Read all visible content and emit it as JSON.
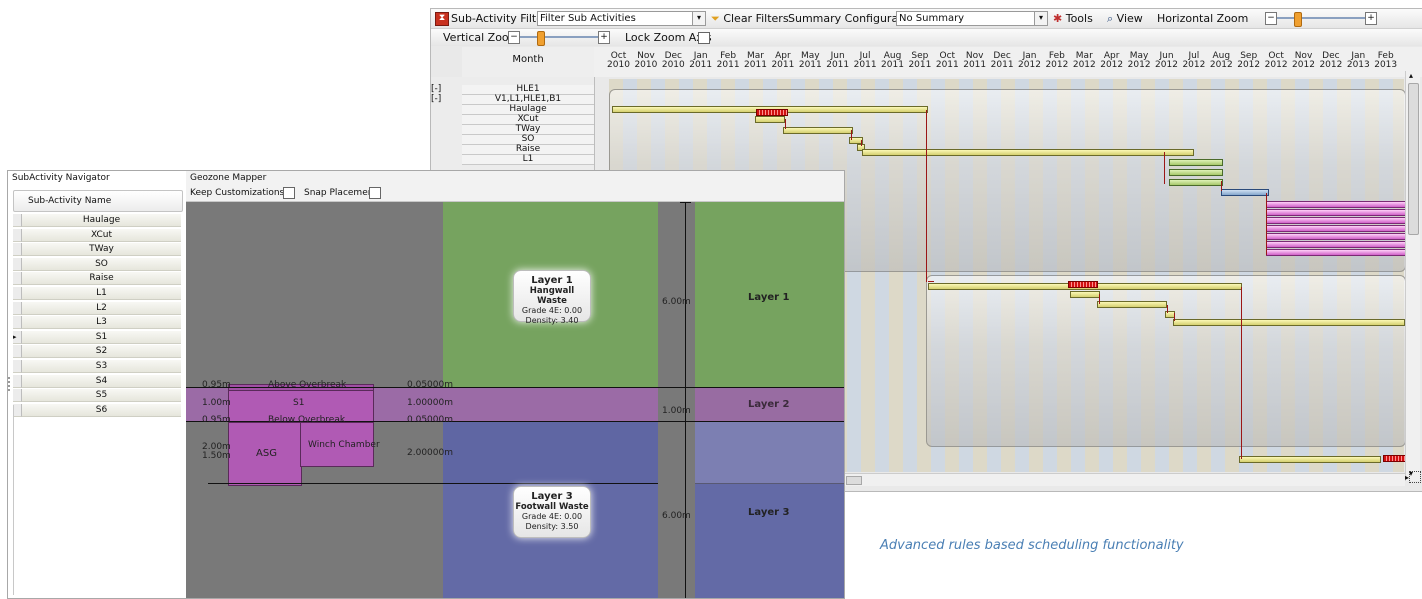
{
  "gantt": {
    "toolbar": {
      "sub_activity_filter_label": "Sub-Activity Filter",
      "sub_activity_filter_value": "Filter Sub Activities",
      "clear_filters_label": "Clear Filters",
      "summary_configuration_label": "Summary Configuration",
      "summary_configuration_value": "No Summary",
      "tools_label": "Tools",
      "view_label": "View",
      "horizontal_zoom_label": "Horizontal Zoom",
      "vertical_zoom_label": "Vertical Zoom",
      "lock_zoom_axis_label": "Lock Zoom Axis",
      "lock_zoom_axis_checked": false
    },
    "column_header": "Month",
    "months": [
      [
        "Oct",
        "2010"
      ],
      [
        "Nov",
        "2010"
      ],
      [
        "Dec",
        "2010"
      ],
      [
        "Jan",
        "2011"
      ],
      [
        "Feb",
        "2011"
      ],
      [
        "Mar",
        "2011"
      ],
      [
        "Apr",
        "2011"
      ],
      [
        "May",
        "2011"
      ],
      [
        "Jun",
        "2011"
      ],
      [
        "Jul",
        "2011"
      ],
      [
        "Aug",
        "2011"
      ],
      [
        "Sep",
        "2011"
      ],
      [
        "Oct",
        "2011"
      ],
      [
        "Nov",
        "2011"
      ],
      [
        "Dec",
        "2011"
      ],
      [
        "Jan",
        "2012"
      ],
      [
        "Feb",
        "2012"
      ],
      [
        "Mar",
        "2012"
      ],
      [
        "Apr",
        "2012"
      ],
      [
        "May",
        "2012"
      ],
      [
        "Jun",
        "2012"
      ],
      [
        "Jul",
        "2012"
      ],
      [
        "Aug",
        "2012"
      ],
      [
        "Sep",
        "2012"
      ],
      [
        "Oct",
        "2012"
      ],
      [
        "Nov",
        "2012"
      ],
      [
        "Dec",
        "2012"
      ],
      [
        "Jan",
        "2013"
      ],
      [
        "Feb",
        "2013"
      ]
    ],
    "tree_toggles": [
      "[-]",
      "[-]"
    ],
    "rows": [
      "HLE1",
      "V1,L1,HLE1,B1",
      "Haulage",
      "XCut",
      "TWay",
      "SO",
      "Raise",
      "L1"
    ]
  },
  "navigator": {
    "title": "SubActivity Navigator",
    "column_header": "Sub-Activity Name",
    "items": [
      "Haulage",
      "XCut",
      "TWay",
      "SO",
      "Raise",
      "L1",
      "L2",
      "L3",
      "S1",
      "S2",
      "S3",
      "S4",
      "S5",
      "S6"
    ],
    "selected_row_marker": "▸"
  },
  "geozone": {
    "title": "Geozone Mapper",
    "keep_customizations_label": "Keep Customizations",
    "keep_customizations_checked": false,
    "snap_placement_label": "Snap Placement",
    "snap_placement_checked": false,
    "overbreak_above": {
      "left_value": "0.95m",
      "label": "Above Overbreak",
      "right_value": "0.05000m"
    },
    "s1_row": {
      "left_value": "1.00m",
      "label": "S1",
      "right_value": "1.00000m"
    },
    "overbreak_below": {
      "left_value": "0.95m",
      "label": "Below Overbreak",
      "right_value": "0.05000m"
    },
    "asg_row": {
      "left_value_1": "2.00m",
      "left_value_2": "1.50m",
      "label": "ASG",
      "winch_label": "Winch Chamber",
      "right_value": "2.00000m"
    },
    "layers": [
      {
        "card_title": "Layer 1",
        "card_subtitle": "Hangwall Waste",
        "grade": "Grade 4E: 0.00",
        "density": "Density: 3.40",
        "thickness": "6.00m",
        "label": "Layer 1"
      },
      {
        "thickness": "1.00m",
        "label": "Layer 2"
      },
      {
        "card_title": "Layer 3",
        "card_subtitle": "Footwall Waste",
        "grade": "Grade 4E: 0.00",
        "density": "Density: 3.50",
        "thickness": "6.00m",
        "label": "Layer 3"
      }
    ],
    "colors": {
      "layer1": "#76a35f",
      "layer2": "#9d6aa9",
      "layer3": "#636aa6",
      "excavation": "#b05ab4",
      "background": "#797979"
    }
  },
  "caption": "Advanced rules based scheduling functionality"
}
